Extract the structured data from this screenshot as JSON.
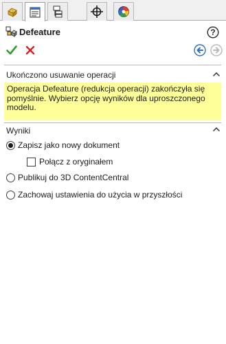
{
  "tabs": [
    {
      "name": "feature-manager",
      "icon": "feature-manager-icon",
      "active": false
    },
    {
      "name": "property-manager",
      "icon": "property-manager-icon",
      "active": true
    },
    {
      "name": "configuration-manager",
      "icon": "configuration-manager-icon",
      "active": false
    },
    {
      "name": "dimxpert-manager",
      "icon": "crosshair-icon",
      "active": false
    },
    {
      "name": "display-manager",
      "icon": "appearance-sphere-icon",
      "active": false
    }
  ],
  "header": {
    "title": "Defeature",
    "title_icon": "defeature-icon",
    "help_label": "?"
  },
  "actions": {
    "ok": "check-icon",
    "cancel": "cancel-x-icon",
    "back": "back-arrow-icon",
    "forward": "forward-arrow-icon"
  },
  "status_section": {
    "title": "Ukończono usuwanie operacji",
    "message_lines": [
      "Operacja Defeature (redukcja operacji) zakończyła się",
      "pomyślnie. Wybierz opcję wyników dla uproszczonego",
      "modelu."
    ]
  },
  "results_section": {
    "title": "Wyniki",
    "options": {
      "save_new": {
        "label": "Zapisz jako nowy dokument",
        "selected": true
      },
      "link_original": {
        "label": "Połącz z oryginałem",
        "checked": false
      },
      "publish": {
        "label": "Publikuj do 3D ContentCentral",
        "selected": false
      },
      "keep_settings": {
        "label": "Zachowaj ustawienia do użycia w przyszłości",
        "selected": false
      }
    }
  },
  "colors": {
    "message_bg": "#ffff99",
    "ok_green": "#2e9e2e",
    "cancel_red": "#d82020",
    "nav_blue": "#2f6fc2"
  }
}
